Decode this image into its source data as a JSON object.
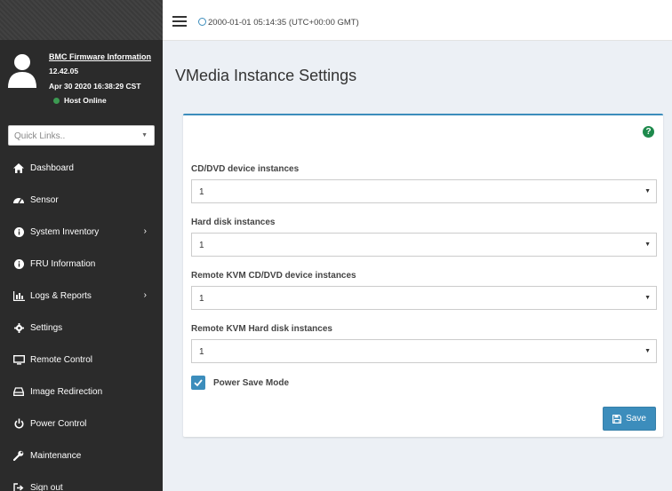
{
  "header": {
    "datetime": "2000-01-01 05:14:35 (UTC+00:00 GMT)"
  },
  "user_panel": {
    "firmware_link": "BMC Firmware Information",
    "version": "12.42.05",
    "build_date": "Apr 30 2020 16:38:29 CST",
    "host_status": "Host Online",
    "host_status_color": "#3c9a52"
  },
  "quick_links": {
    "placeholder": "Quick Links.."
  },
  "sidebar": {
    "items": [
      {
        "label": "Dashboard",
        "icon": "home-icon"
      },
      {
        "label": "Sensor",
        "icon": "tachometer-icon"
      },
      {
        "label": "System Inventory",
        "icon": "info-icon",
        "has_submenu": true
      },
      {
        "label": "FRU Information",
        "icon": "info-icon"
      },
      {
        "label": "Logs & Reports",
        "icon": "bar-chart-icon",
        "has_submenu": true
      },
      {
        "label": "Settings",
        "icon": "gear-icon"
      },
      {
        "label": "Remote Control",
        "icon": "monitor-icon"
      },
      {
        "label": "Image Redirection",
        "icon": "drive-icon"
      },
      {
        "label": "Power Control",
        "icon": "power-icon"
      },
      {
        "label": "Maintenance",
        "icon": "wrench-icon"
      },
      {
        "label": "Sign out",
        "icon": "sign-out-icon"
      }
    ]
  },
  "main": {
    "title": "VMedia Instance Settings",
    "fields": [
      {
        "label": "CD/DVD device instances",
        "value": "1"
      },
      {
        "label": "Hard disk instances",
        "value": "1"
      },
      {
        "label": "Remote KVM CD/DVD device instances",
        "value": "1"
      },
      {
        "label": "Remote KVM Hard disk instances",
        "value": "1"
      }
    ],
    "power_save": {
      "label": "Power Save Mode",
      "checked": true
    },
    "save_label": "Save",
    "help_glyph": "?"
  },
  "colors": {
    "accent": "#3c8dbc",
    "sidebar_bg": "#2b2b2b",
    "help_green": "#1e8a4c"
  }
}
